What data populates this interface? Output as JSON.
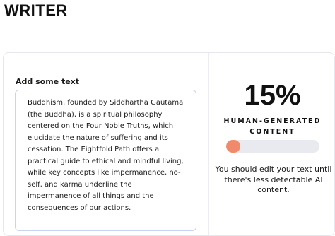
{
  "header": {
    "brand": "WRITER"
  },
  "editor": {
    "label": "Add some text",
    "content": "Buddhism, founded by Siddhartha Gautama (the Buddha), is a spiritual philosophy centered on the Four Noble Truths, which elucidate the nature of suffering and its cessation. The Eightfold Path offers a practical guide to ethical and mindful living, while key concepts like impermanence, no-self, and karma underline the impermanence of all things and the consequences of our actions."
  },
  "result": {
    "percent_text": "15%",
    "percent_value": 0.15,
    "label": "HUMAN-GENERATED CONTENT",
    "advice": "You should edit your text until there's less detectable AI content.",
    "bar_color": "#f08a6a",
    "track_color": "#e9e9f0"
  }
}
